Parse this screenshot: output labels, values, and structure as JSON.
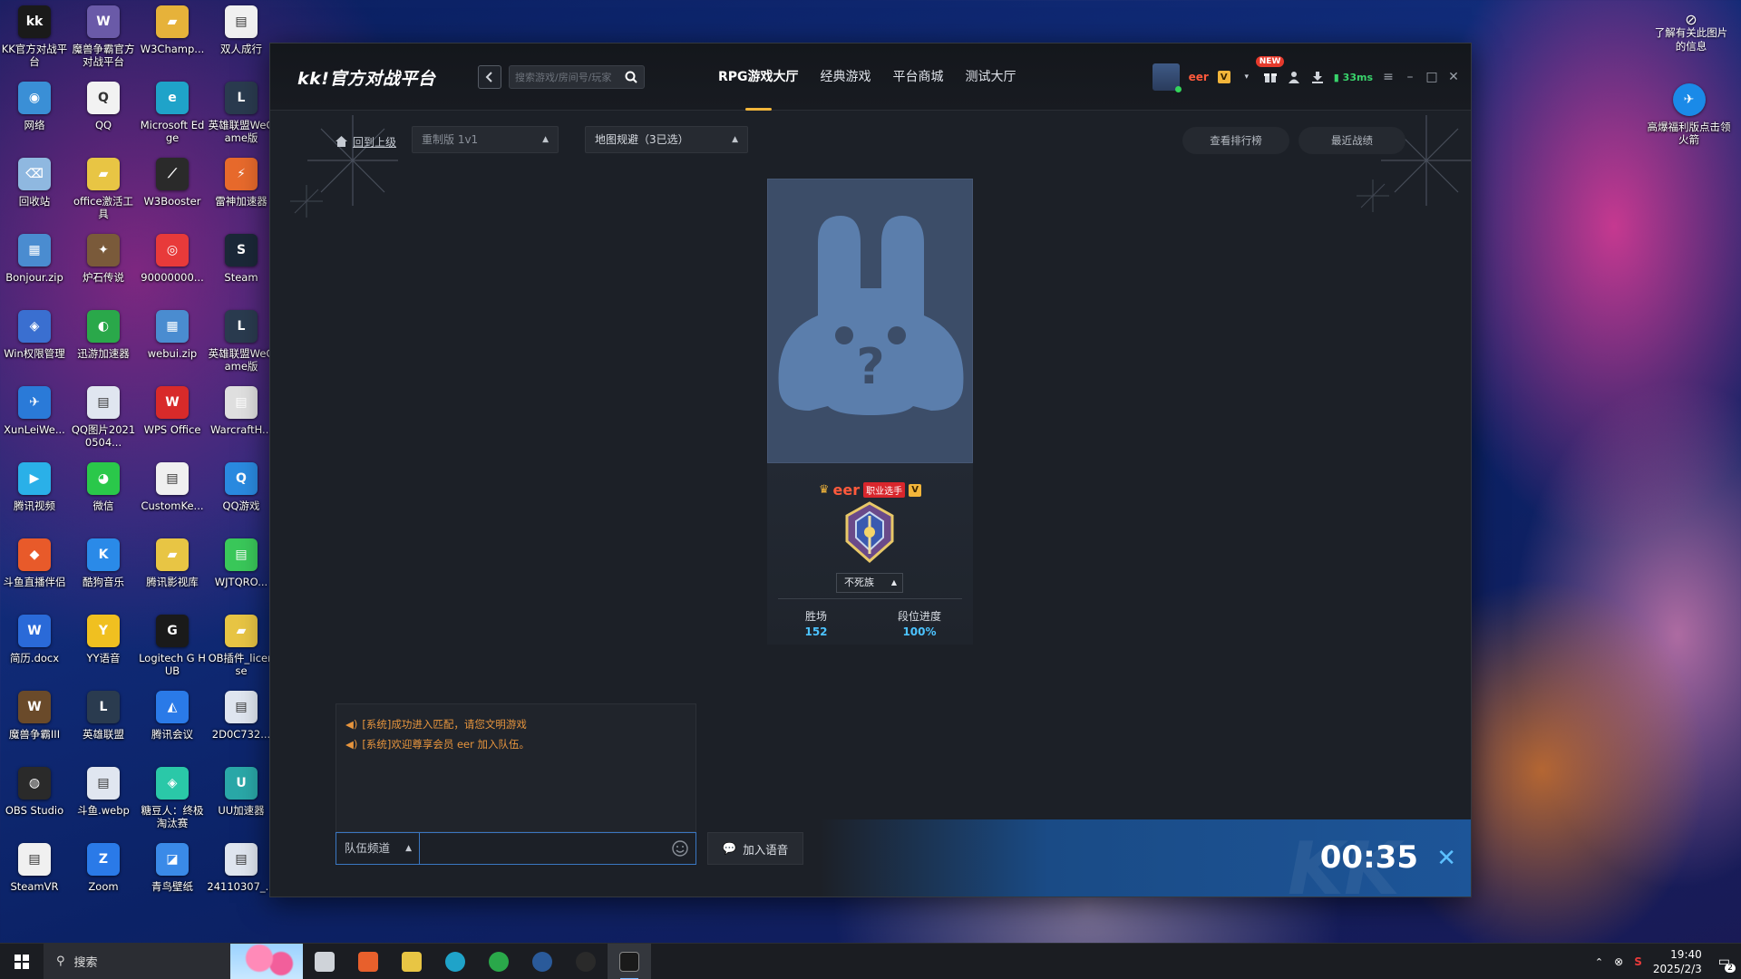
{
  "desktop": {
    "left_icons": [
      {
        "label": "KK官方对战平台",
        "color": "#1a1a1a",
        "glyph": "kk"
      },
      {
        "label": "魔兽争霸官方对战平台",
        "color": "#6a5aa8",
        "glyph": "W"
      },
      {
        "label": "W3Champ...",
        "color": "#e6b23a",
        "glyph": "▰"
      },
      {
        "label": "双人成行",
        "color": "#f0f0f0",
        "glyph": "▤"
      },
      {
        "label": "网络",
        "color": "#3a8fd6",
        "glyph": "◉"
      },
      {
        "label": "QQ",
        "color": "#f2f2f2",
        "glyph": "Q"
      },
      {
        "label": "Microsoft Edge",
        "color": "#1fa3c9",
        "glyph": "e"
      },
      {
        "label": "英雄联盟WeGame版",
        "color": "#2a3b4f",
        "glyph": "L"
      },
      {
        "label": "回收站",
        "color": "#8fb8e0",
        "glyph": "⌫"
      },
      {
        "label": "office激活工具",
        "color": "#e8c544",
        "glyph": "▰"
      },
      {
        "label": "W3Booster",
        "color": "#2a2a2a",
        "glyph": "⟋"
      },
      {
        "label": "雷神加速器",
        "color": "#e86a2c",
        "glyph": "⚡"
      },
      {
        "label": "Bonjour.zip",
        "color": "#4a8cd0",
        "glyph": "▦"
      },
      {
        "label": "炉石传说",
        "color": "#7a5a3a",
        "glyph": "✦"
      },
      {
        "label": "90000000...",
        "color": "#e83a3a",
        "glyph": "◎"
      },
      {
        "label": "Steam",
        "color": "#1b2838",
        "glyph": "S"
      },
      {
        "label": "Win权限管理",
        "color": "#3a6fd0",
        "glyph": "◈"
      },
      {
        "label": "迅游加速器",
        "color": "#2aa84a",
        "glyph": "◐"
      },
      {
        "label": "webui.zip",
        "color": "#4a8cd0",
        "glyph": "▦"
      },
      {
        "label": "英雄联盟WeGame版",
        "color": "#2a3b4f",
        "glyph": "L"
      },
      {
        "label": "XunLeiWe...",
        "color": "#2a7ad8",
        "glyph": "✈"
      },
      {
        "label": "QQ图片20210504...",
        "color": "#e0e6f0",
        "glyph": "▤"
      },
      {
        "label": "WPS Office",
        "color": "#d82a2a",
        "glyph": "W"
      },
      {
        "label": "WarcraftH...",
        "color": "#e0e0e0",
        "glyph": "▤"
      },
      {
        "label": "腾讯视频",
        "color": "#2ab0e8",
        "glyph": "▶"
      },
      {
        "label": "微信",
        "color": "#2ac84a",
        "glyph": "◕"
      },
      {
        "label": "CustomKe...",
        "color": "#f0f0f0",
        "glyph": "▤"
      },
      {
        "label": "QQ游戏",
        "color": "#2a8ae0",
        "glyph": "Q"
      },
      {
        "label": "斗鱼直播伴侣",
        "color": "#e85a2a",
        "glyph": "◆"
      },
      {
        "label": "酷狗音乐",
        "color": "#2a8ae8",
        "glyph": "K"
      },
      {
        "label": "腾讯影视库",
        "color": "#e8c544",
        "glyph": "▰"
      },
      {
        "label": "WJTQRO...",
        "color": "#3ac85a",
        "glyph": "▤"
      },
      {
        "label": "简历.docx",
        "color": "#2a6ad8",
        "glyph": "W"
      },
      {
        "label": "YY语音",
        "color": "#f0c020",
        "glyph": "Y"
      },
      {
        "label": "Logitech G HUB",
        "color": "#1a1a1a",
        "glyph": "G"
      },
      {
        "label": "OB插件_license",
        "color": "#e8c544",
        "glyph": "▰"
      },
      {
        "label": "魔兽争霸III",
        "color": "#6a4a2a",
        "glyph": "W"
      },
      {
        "label": "英雄联盟",
        "color": "#2a3b4f",
        "glyph": "L"
      },
      {
        "label": "腾讯会议",
        "color": "#2a7ae8",
        "glyph": "◭"
      },
      {
        "label": "2D0C732...",
        "color": "#e0e6f0",
        "glyph": "▤"
      },
      {
        "label": "OBS Studio",
        "color": "#2a2a2a",
        "glyph": "◍"
      },
      {
        "label": "斗鱼.webp",
        "color": "#e0e6f0",
        "glyph": "▤"
      },
      {
        "label": "糖豆人：终极淘汰赛",
        "color": "#2ac8a8",
        "glyph": "◈"
      },
      {
        "label": "UU加速器",
        "color": "#2aa8a8",
        "glyph": "U"
      },
      {
        "label": "SteamVR",
        "color": "#f0f0f0",
        "glyph": "▤"
      },
      {
        "label": "Zoom",
        "color": "#2a7ae8",
        "glyph": "Z"
      },
      {
        "label": "青鸟壁纸",
        "color": "#3a8ae8",
        "glyph": "◪"
      },
      {
        "label": "24110307_...",
        "color": "#e0e6f0",
        "glyph": "▤"
      }
    ],
    "right_icons": [
      {
        "label": "高爆福利版点击领火箭",
        "color": "#1a8ae8",
        "glyph": "✈"
      }
    ],
    "hint_text": "了解有关此图片的信息"
  },
  "app": {
    "logo": "kk!官方对战平台",
    "search_placeholder": "搜索游戏/房间号/玩家",
    "nav_tabs": [
      {
        "label": "RPG游戏大厅",
        "active": true
      },
      {
        "label": "经典游戏",
        "active": false
      },
      {
        "label": "平台商城",
        "active": false
      },
      {
        "label": "测试大厅",
        "active": false
      }
    ],
    "user": {
      "name": "eer",
      "vip": "V",
      "new_badge": "NEW",
      "ping": "33ms"
    },
    "toolbar": {
      "back_link": "回到上级",
      "mode_select": "重制版 1v1",
      "map_select": "地图规避（3已选）",
      "leaderboard_btn": "查看排行榜",
      "recent_btn": "最近战绩"
    },
    "player_card": {
      "name": "eer",
      "pro_tag": "职业选手",
      "vip": "V",
      "race": "不死族",
      "stats": [
        {
          "label": "胜场",
          "value": "152"
        },
        {
          "label": "段位进度",
          "value": "100%"
        }
      ]
    },
    "chat": {
      "messages": [
        "[系统]成功进入匹配，请您文明游戏",
        "[系统]欢迎尊享会员 eer 加入队伍。"
      ],
      "channel": "队伍频道",
      "input_value": "",
      "voice_btn": "加入语音"
    },
    "timer": "00:35"
  },
  "taskbar": {
    "search_placeholder": "搜索",
    "apps": [
      {
        "name": "task-view",
        "color": "#cfd3d9"
      },
      {
        "name": "douyu",
        "color": "#e8602c"
      },
      {
        "name": "explorer",
        "color": "#e8c544"
      },
      {
        "name": "edge",
        "color": "#1fa3c9"
      },
      {
        "name": "xunyou",
        "color": "#2aa84a"
      },
      {
        "name": "steam",
        "color": "#2a5a9a"
      },
      {
        "name": "obs-record",
        "color": "#2a2a2a"
      },
      {
        "name": "kk",
        "color": "#1a1a1a"
      }
    ],
    "time": "19:40",
    "date": "2025/2/3",
    "notify_count": "2"
  }
}
